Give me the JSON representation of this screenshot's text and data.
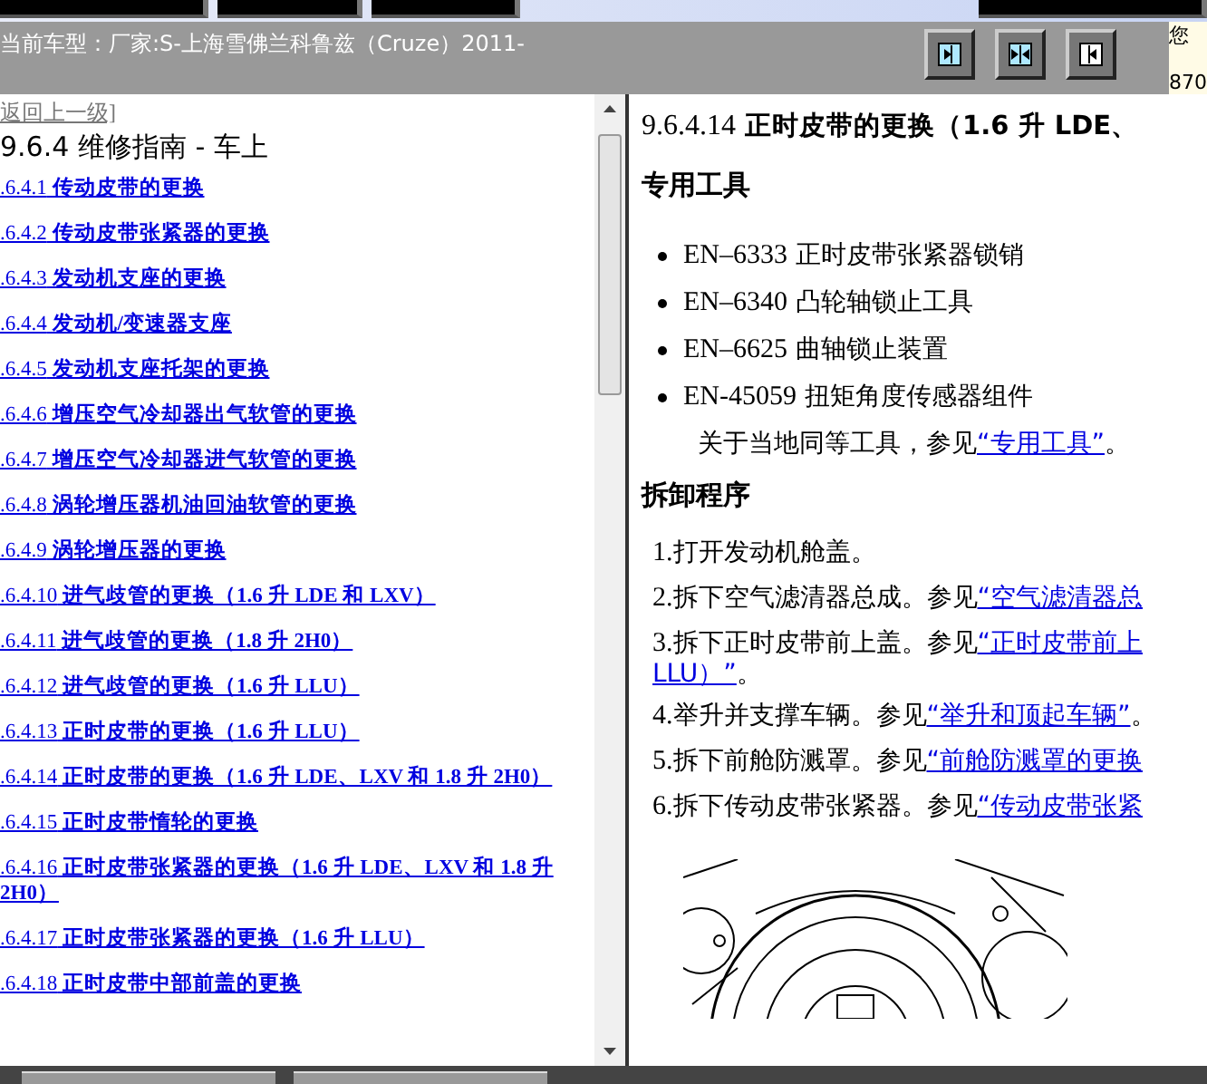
{
  "toolbar": {
    "vehicle_label": "当前车型：",
    "vehicle": "厂家:S-上海雪佛兰科鲁兹（Cruze）2011-"
  },
  "user_panel": {
    "greeting": "您",
    "code": "870"
  },
  "nav": {
    "back_link": "返回上一级]",
    "heading_number": "9.6.4",
    "heading": "维修指南 - 车上",
    "items": [
      {
        "number": ".6.4.1",
        "title": "传动皮带的更换"
      },
      {
        "number": ".6.4.2",
        "title": "传动皮带张紧器的更换"
      },
      {
        "number": ".6.4.3",
        "title": "发动机支座的更换"
      },
      {
        "number": ".6.4.4",
        "title": "发动机/变速器支座"
      },
      {
        "number": ".6.4.5",
        "title": "发动机支座托架的更换"
      },
      {
        "number": ".6.4.6",
        "title": "增压空气冷却器出气软管的更换"
      },
      {
        "number": ".6.4.7",
        "title": "增压空气冷却器进气软管的更换"
      },
      {
        "number": ".6.4.8",
        "title": "涡轮增压器机油回油软管的更换"
      },
      {
        "number": ".6.4.9",
        "title": "涡轮增压器的更换"
      },
      {
        "number": ".6.4.10",
        "title": "进气歧管的更换（1.6 升 LDE 和 LXV）"
      },
      {
        "number": ".6.4.11",
        "title": "进气歧管的更换（1.8 升 2H0）"
      },
      {
        "number": ".6.4.12",
        "title": "进气歧管的更换（1.6 升 LLU）"
      },
      {
        "number": ".6.4.13",
        "title": "正时皮带的更换（1.6 升 LLU）"
      },
      {
        "number": ".6.4.14",
        "title": "正时皮带的更换（1.6 升 LDE、LXV 和 1.8 升 2H0）"
      },
      {
        "number": ".6.4.15",
        "title": "正时皮带惰轮的更换"
      },
      {
        "number": ".6.4.16",
        "title": "正时皮带张紧器的更换（1.6 升 LDE、LXV 和 1.8 升 2H0）"
      },
      {
        "number": ".6.4.17",
        "title": "正时皮带张紧器的更换（1.6 升 LLU）"
      },
      {
        "number": ".6.4.18",
        "title": "正时皮带中部前盖的更换"
      }
    ]
  },
  "article": {
    "title_number": "9.6.4.14",
    "title": "正时皮带的更换（1.6 升 LDE、",
    "tools_heading": "专用工具",
    "tools": [
      {
        "code": "EN–6333",
        "name": "正时皮带张紧器锁销"
      },
      {
        "code": "EN–6340",
        "name": "凸轮轴锁止工具"
      },
      {
        "code": "EN–6625",
        "name": "曲轴锁止装置"
      },
      {
        "code": "EN-45059",
        "name": "扭矩角度传感器组件"
      }
    ],
    "tools_note": {
      "text": "关于当地同等工具，参见",
      "link": "“专用工具”",
      "end": "。"
    },
    "procedure_heading": "拆卸程序",
    "steps": [
      {
        "number": "1.",
        "text": "打开发动机舱盖。"
      },
      {
        "number": "2.",
        "text": "拆下空气滤清器总成。参见",
        "link": "“空气滤清器总"
      },
      {
        "number": "3.",
        "text": "拆下正时皮带前上盖。参见",
        "link": "“正时皮带前上",
        "link_continued": "LLU）”",
        "end": "。"
      },
      {
        "number": "4.",
        "text": "举升并支撑车辆。参见",
        "link": "“举升和顶起车辆”",
        "end": "。"
      },
      {
        "number": "5.",
        "text": "拆下前舱防溅罩。参见",
        "link": "“前舱防溅罩的更换"
      },
      {
        "number": "6.",
        "text": "拆下传动皮带张紧器。参见",
        "link": "“传动皮带张紧"
      }
    ]
  }
}
